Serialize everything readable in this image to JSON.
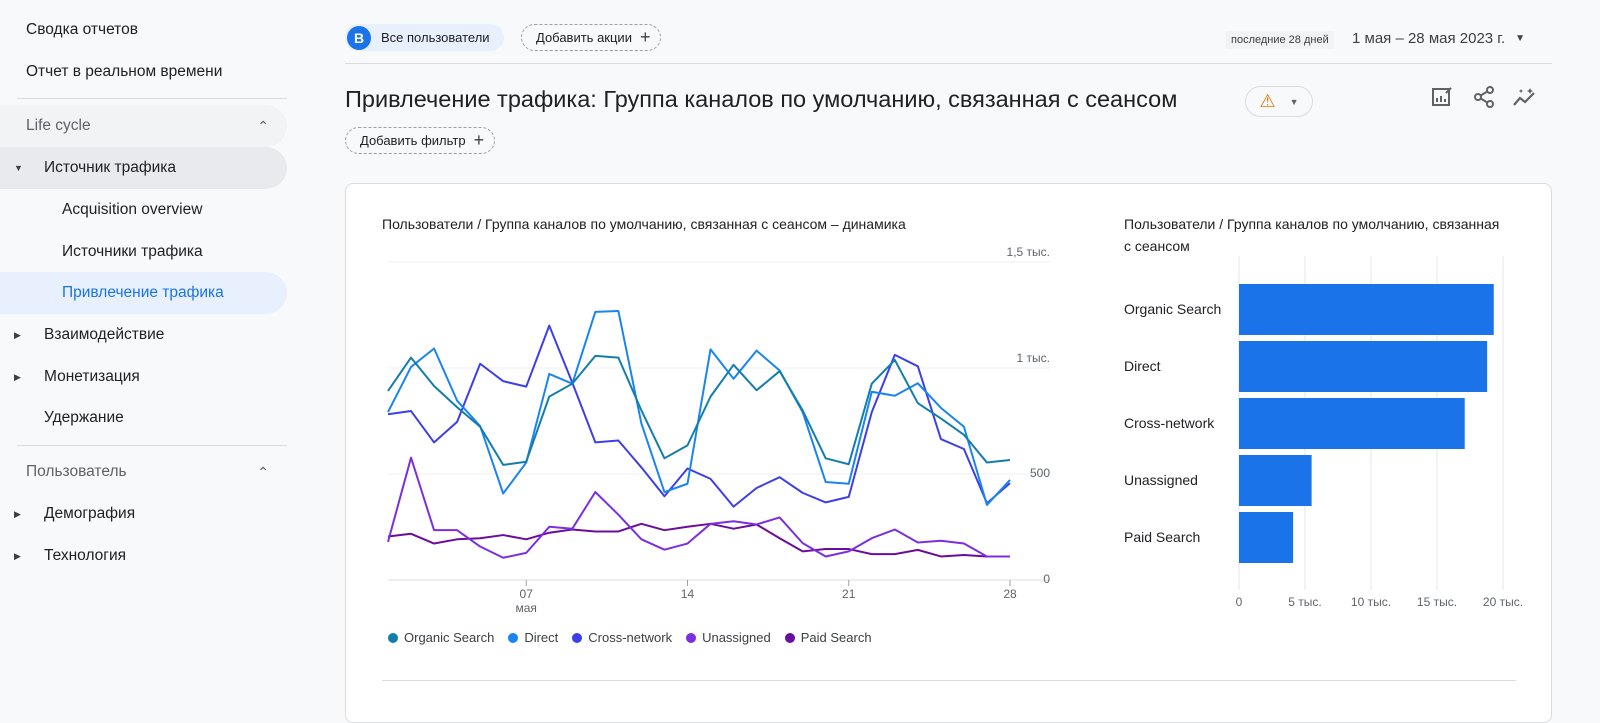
{
  "sidebar": {
    "items": [
      {
        "label": "Сводка отчетов"
      },
      {
        "label": "Отчет в реальном времени"
      },
      {
        "label": "Life cycle"
      },
      {
        "label": "Источник трафика"
      },
      {
        "label": "Acquisition overview"
      },
      {
        "label": "Источники трафика"
      },
      {
        "label": "Привлечение трафика"
      },
      {
        "label": "Взаимодействие"
      },
      {
        "label": "Монетизация"
      },
      {
        "label": "Удержание"
      },
      {
        "label": "Пользователь"
      },
      {
        "label": "Демография"
      },
      {
        "label": "Технология"
      }
    ]
  },
  "header": {
    "segment_avatar": "B",
    "segment_label": "Все пользователи",
    "add_comparison": "Добавить акции",
    "date_badge": "последние 28 дней",
    "date_range": "1 мая – 28 мая 2023 г.",
    "title": "Привлечение трафика: Группа каналов по умолчанию, связанная с сеансом",
    "add_filter": "Добавить фильтр"
  },
  "colors": {
    "accent": "#1a73e8",
    "bar": "#1a73e8",
    "warning": "#e37400"
  },
  "chart_data": [
    {
      "type": "line",
      "title": "Пользователи / Группа каналов по умолчанию, связанная с сеансом – динамика",
      "x": [
        1,
        2,
        3,
        4,
        5,
        6,
        7,
        8,
        9,
        10,
        11,
        12,
        13,
        14,
        15,
        16,
        17,
        18,
        19,
        20,
        21,
        22,
        23,
        24,
        25,
        26,
        27,
        28
      ],
      "xticks": [
        {
          "day": 7,
          "label": "07",
          "sub": "мая"
        },
        {
          "day": 14,
          "label": "14",
          "sub": ""
        },
        {
          "day": 21,
          "label": "21",
          "sub": ""
        },
        {
          "day": 28,
          "label": "28",
          "sub": ""
        }
      ],
      "yticks": [
        {
          "v": 0,
          "label": "0"
        },
        {
          "v": 500,
          "label": "500"
        },
        {
          "v": 1000,
          "label": "1 тыс."
        },
        {
          "v": 1500,
          "label": "1,5 тыс."
        }
      ],
      "ylim": [
        0,
        1500
      ],
      "grid": true,
      "legend_position": "bottom",
      "series": [
        {
          "name": "Organic Search",
          "color": "#137eac",
          "values": [
            892,
            1049,
            915,
            815,
            723,
            543,
            558,
            865,
            926,
            1057,
            1049,
            800,
            574,
            635,
            865,
            1015,
            895,
            985,
            800,
            574,
            546,
            926,
            1038,
            834,
            762,
            685,
            554,
            566
          ]
        },
        {
          "name": "Direct",
          "color": "#1a85f0",
          "values": [
            792,
            1005,
            1092,
            846,
            726,
            408,
            554,
            972,
            926,
            1265,
            1269,
            738,
            415,
            454,
            1088,
            949,
            1082,
            988,
            792,
            462,
            454,
            888,
            869,
            928,
            812,
            723,
            354,
            472
          ]
        },
        {
          "name": "Cross-network",
          "color": "#3d3fe8",
          "values": [
            782,
            797,
            649,
            746,
            1020,
            938,
            912,
            1200,
            931,
            649,
            658,
            531,
            395,
            526,
            477,
            346,
            434,
            485,
            411,
            366,
            392,
            792,
            1062,
            1008,
            665,
            618,
            362,
            457
          ]
        },
        {
          "name": "Unassigned",
          "color": "#7a2fe0",
          "values": [
            180,
            577,
            235,
            235,
            158,
            105,
            128,
            251,
            242,
            415,
            308,
            192,
            143,
            172,
            265,
            277,
            262,
            295,
            174,
            111,
            135,
            197,
            238,
            177,
            185,
            172,
            111,
            111
          ]
        },
        {
          "name": "Paid Search",
          "color": "#6a0d9e",
          "values": [
            205,
            218,
            172,
            192,
            197,
            212,
            192,
            223,
            238,
            229,
            229,
            265,
            235,
            251,
            265,
            242,
            262,
            197,
            135,
            146,
            146,
            122,
            122,
            142,
            111,
            118,
            111,
            111
          ]
        }
      ]
    },
    {
      "type": "bar",
      "orientation": "horizontal",
      "title": "Пользователи / Группа каналов по умолчанию, связанная с сеансом",
      "categories": [
        "Organic Search",
        "Direct",
        "Cross-network",
        "Unassigned",
        "Paid Search"
      ],
      "values": [
        19300,
        18800,
        17100,
        5500,
        4100
      ],
      "xlim": [
        0,
        20000
      ],
      "xticks": [
        {
          "v": 0,
          "label": "0"
        },
        {
          "v": 5000,
          "label": "5 тыс."
        },
        {
          "v": 10000,
          "label": "10 тыс."
        },
        {
          "v": 15000,
          "label": "15 тыс."
        },
        {
          "v": 20000,
          "label": "20 тыс."
        }
      ],
      "grid": true
    }
  ]
}
